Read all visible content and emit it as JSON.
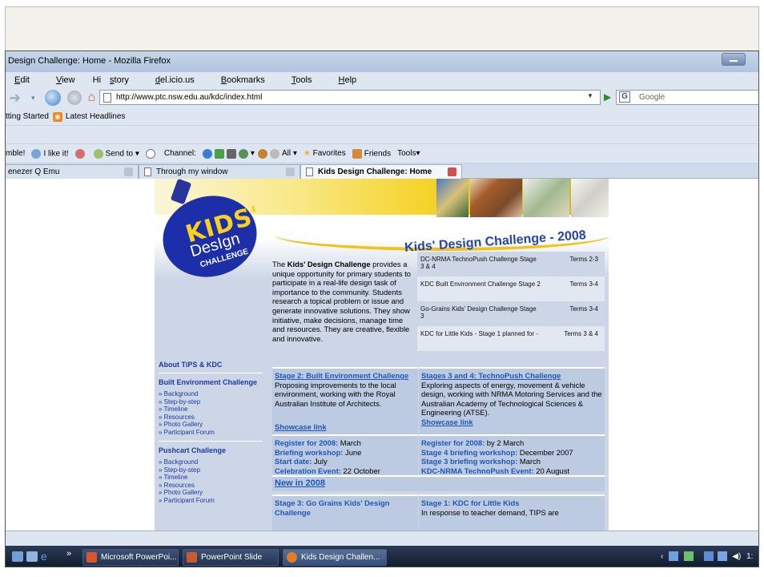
{
  "window": {
    "title": "Design Challenge: Home - Mozilla Firefox"
  },
  "menu": [
    {
      "pre": "",
      "key": "E",
      "rest": "dit"
    },
    {
      "pre": "",
      "key": "V",
      "rest": "iew"
    },
    {
      "pre": "Hi",
      "key": "s",
      "rest": "tory"
    },
    {
      "pre": "",
      "key": "d",
      "rest": "el.icio.us"
    },
    {
      "pre": "",
      "key": "B",
      "rest": "ookmarks"
    },
    {
      "pre": "",
      "key": "T",
      "rest": "ools"
    },
    {
      "pre": "",
      "key": "H",
      "rest": "elp"
    }
  ],
  "nav": {
    "url": "http://www.ptc.nsw.edu.au/kdc/index.html",
    "search_placeholder": "Google"
  },
  "bookmarks": {
    "getting_started": "tting Started",
    "latest_headlines": "Latest Headlines"
  },
  "toolbar2": {
    "stumble": "mble!",
    "like": "I like it!",
    "send": "Send to",
    "channel": "Channel:",
    "all": "All",
    "favorites": "Favorites",
    "friends": "Friends",
    "tools": "Tools"
  },
  "tabs": [
    {
      "label": "enezer Q Emu"
    },
    {
      "label": "Through my window"
    },
    {
      "label": "Kids Design Challenge: Home"
    }
  ],
  "site": {
    "logo_kids": "KIDS'",
    "logo_design": "DesIgn",
    "logo_challenge": "CHALLENGE",
    "title": "Kids' Design Challenge - 2008",
    "intro_pre": "The ",
    "intro_bold": "Kids' Design Challenge",
    "intro_post": " provides a unique opportunity for primary students to participate in a real-life design task of importance to the community. Students research a topical problem or issue and generate innovative solutions. They show initiative, make decisions, manage time and resources. They are creative, flexible and innovative.",
    "terms": [
      {
        "name": "DC-NRMA TechnoPush Challenge Stage 3 & 4",
        "term": "Terms 2-3"
      },
      {
        "name": "KDC Built Environment Challenge Stage 2",
        "term": "Terms 3-4"
      },
      {
        "name": "Go-Grains Kids' Design Challenge Stage 3",
        "term": "Terms 3-4"
      },
      {
        "name": "KDC for Little Kids - Stage 1 planned for -",
        "term": "Terms 3 & 4"
      }
    ],
    "sidenav": {
      "about": "About TiPS & KDC",
      "built_heading": "Built Environment Challenge",
      "built_links": [
        "» Background",
        "» Step-by-step",
        "» Timeline",
        "» Resources",
        "» Photo Gallery",
        "» Participant Forum"
      ],
      "push_heading": "Pushcart Challenge",
      "push_links": [
        "» Background",
        "» Step-by-step",
        "» Timeline",
        "» Resources",
        "» Photo Gallery",
        "» Participant Forum"
      ]
    },
    "stage2": {
      "title": "Stage 2: Built Environment Challenge",
      "text": "Proposing improvements to the local environment, working with the Royal Australian Institute of Architects.",
      "link": "Showcase link",
      "reg_label": "Register for 2008:",
      "reg_value": " March",
      "brief_label": "Briefing workshop:",
      "brief_value": " June",
      "start_label": "Start date:",
      "start_value": " July",
      "celeb_label": "Celebration Event:",
      "celeb_value": " 22 October"
    },
    "stage34": {
      "title": "Stages 3 and 4: TechnoPush Challenge",
      "text": "Exploring aspects of energy, movement & vehicle design, working with NRMA Motoring Services and the Australian Academy of Technological Sciences & Engineering (ATSE).",
      "link": "Showcase link",
      "reg_label": "Register for 2008:",
      "reg_value": " by 2 March",
      "s4_label": "Stage 4 briefing workshop:",
      "s4_value": " December 2007",
      "s3_label": "Stage 3 briefing workshop:",
      "s3_value": " March",
      "event_label": "KDC-NRMA TechnoPush Event:",
      "event_value": " 20 August"
    },
    "new_in": "New in 2008",
    "stage3_grains": "Stage 3: Go Grains Kids' Design Challenge",
    "stage1_title": "Stage 1: KDC for Little Kids",
    "stage1_text": "In response to teacher demand, TIPS are"
  },
  "taskbar": {
    "buttons": [
      "Microsoft PowerPoi...",
      "PowerPoint Slide Sh...",
      "Kids Design Challen..."
    ],
    "chevron": "»",
    "clock": "1:"
  }
}
